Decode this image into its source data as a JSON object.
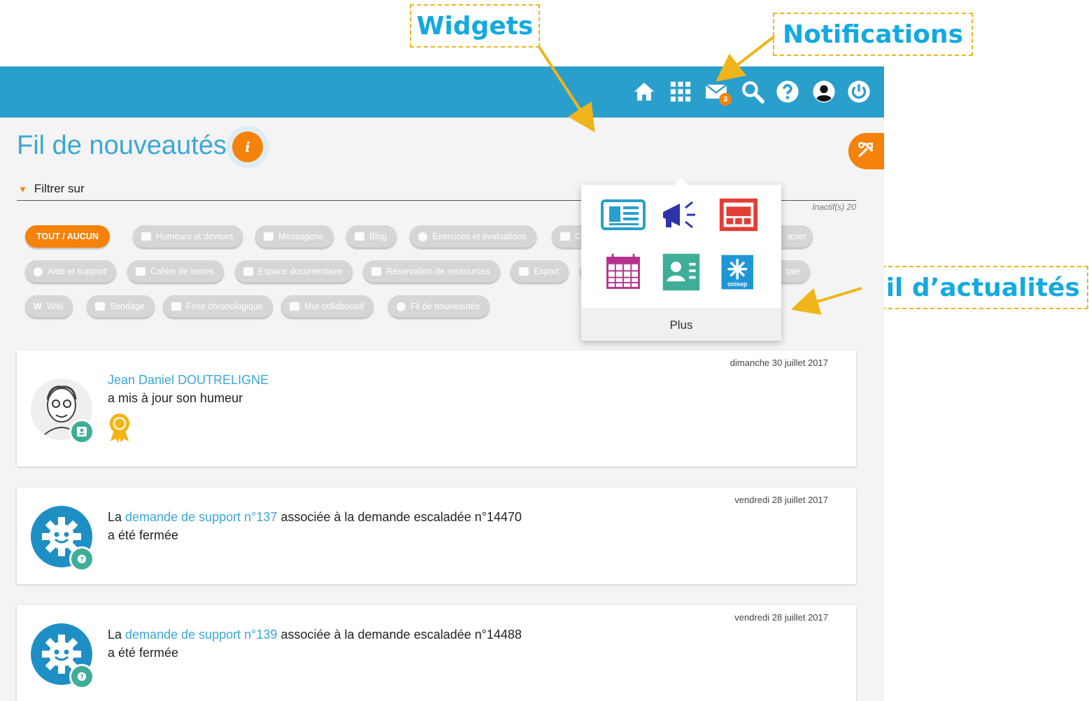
{
  "annotations": {
    "widgets": "Widgets",
    "notifications": "Notifications",
    "news_feed": "Fil d’actualités"
  },
  "topbar": {
    "icons": [
      "home-icon",
      "apps-grid-icon",
      "mail-icon",
      "search-icon",
      "help-icon",
      "user-icon",
      "power-icon"
    ],
    "mail_badge": "3",
    "color": "#2a9fcc"
  },
  "page": {
    "title": "Fil de nouveautés",
    "info_symbol": "i"
  },
  "filter": {
    "label": "Filtrer sur",
    "inactive": "Inactif(s) 20",
    "all_none": "TOUT  /  AUCUN",
    "chips": [
      "Humeurs et devises",
      "Messagerie",
      "Blog",
      "Exercices et évaluations",
      "C",
      "asier",
      "Aide et support",
      "Cahier de textes",
      "Espace documentaire",
      "Réservation de ressources",
      "Export",
      "",
      "",
      "tale",
      "Wiki",
      "Sondage",
      "Frise chronologique",
      "Mur collaboratif",
      "Fil de nouveautés"
    ]
  },
  "widgets_menu": {
    "items": [
      "newspaper-icon",
      "megaphone-icon",
      "screen-icon",
      "calendar-icon",
      "contact-card-icon",
      "onisep-icon"
    ],
    "onisep_label": "onisep",
    "more": "Plus"
  },
  "feed": [
    {
      "date": "dimanche 30 juillet 2017",
      "author": "Jean Daniel DOUTRELIGNE",
      "text": "a mis à jour son humeur"
    },
    {
      "date": "vendredi 28 juillet 2017",
      "prefix": "La",
      "link": "demande de support n°137",
      "suffix": "associée à la demande escaladée  n°14470",
      "line2": "a été fermée"
    },
    {
      "date": "vendredi 28 juillet 2017",
      "prefix": "La",
      "link": "demande de support n°139",
      "suffix": "associée à la demande escaladée  n°14488",
      "line2": "a été fermée"
    }
  ],
  "colors": {
    "accent_orange": "#f5820b",
    "title_blue": "#3aa7d6",
    "callout_text": "#14a9e1",
    "callout_border": "#f0b51a",
    "chip_gray": "#d6d6d6"
  }
}
